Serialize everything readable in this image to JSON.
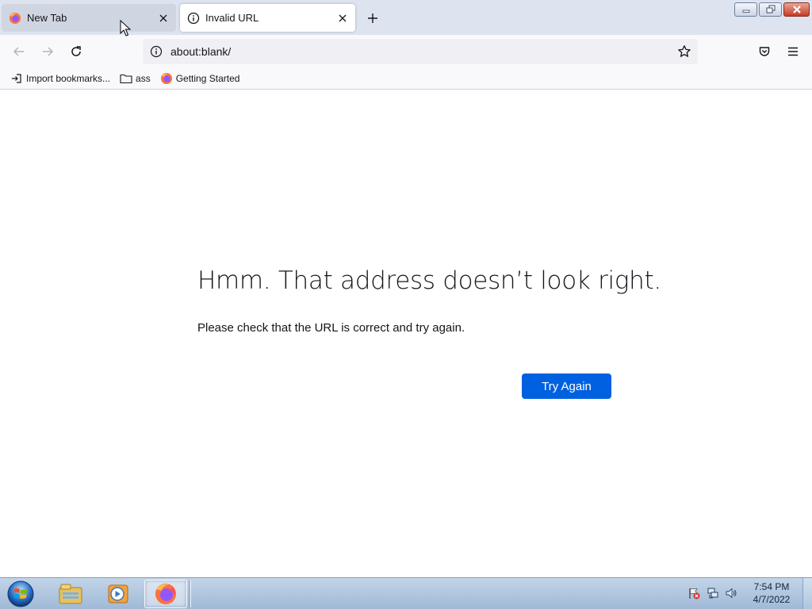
{
  "browser": {
    "tabs": [
      {
        "label": "New Tab",
        "icon": "firefox-icon",
        "active": false
      },
      {
        "label": "Invalid URL",
        "icon": "info-icon",
        "active": true
      }
    ],
    "window_controls": [
      "minimize",
      "maximize",
      "close"
    ]
  },
  "navbar": {
    "url": "about:blank/"
  },
  "bookmarks": [
    {
      "label": "Import bookmarks...",
      "icon": "import-icon"
    },
    {
      "label": "ass",
      "icon": "folder-icon"
    },
    {
      "label": "Getting Started",
      "icon": "firefox-icon"
    }
  ],
  "error_page": {
    "title": "Hmm. That address doesn’t look right.",
    "description": "Please check that the URL is correct and try again.",
    "button_label": "Try Again"
  },
  "taskbar": {
    "apps": [
      "windows-explorer-icon",
      "media-player-icon",
      "firefox-icon"
    ],
    "clock_time": "7:54 PM",
    "clock_date": "4/7/2022"
  },
  "colors": {
    "accent": "#0061e0",
    "tabstrip": "#dde4ef",
    "toolbar": "#f9f9fb"
  }
}
